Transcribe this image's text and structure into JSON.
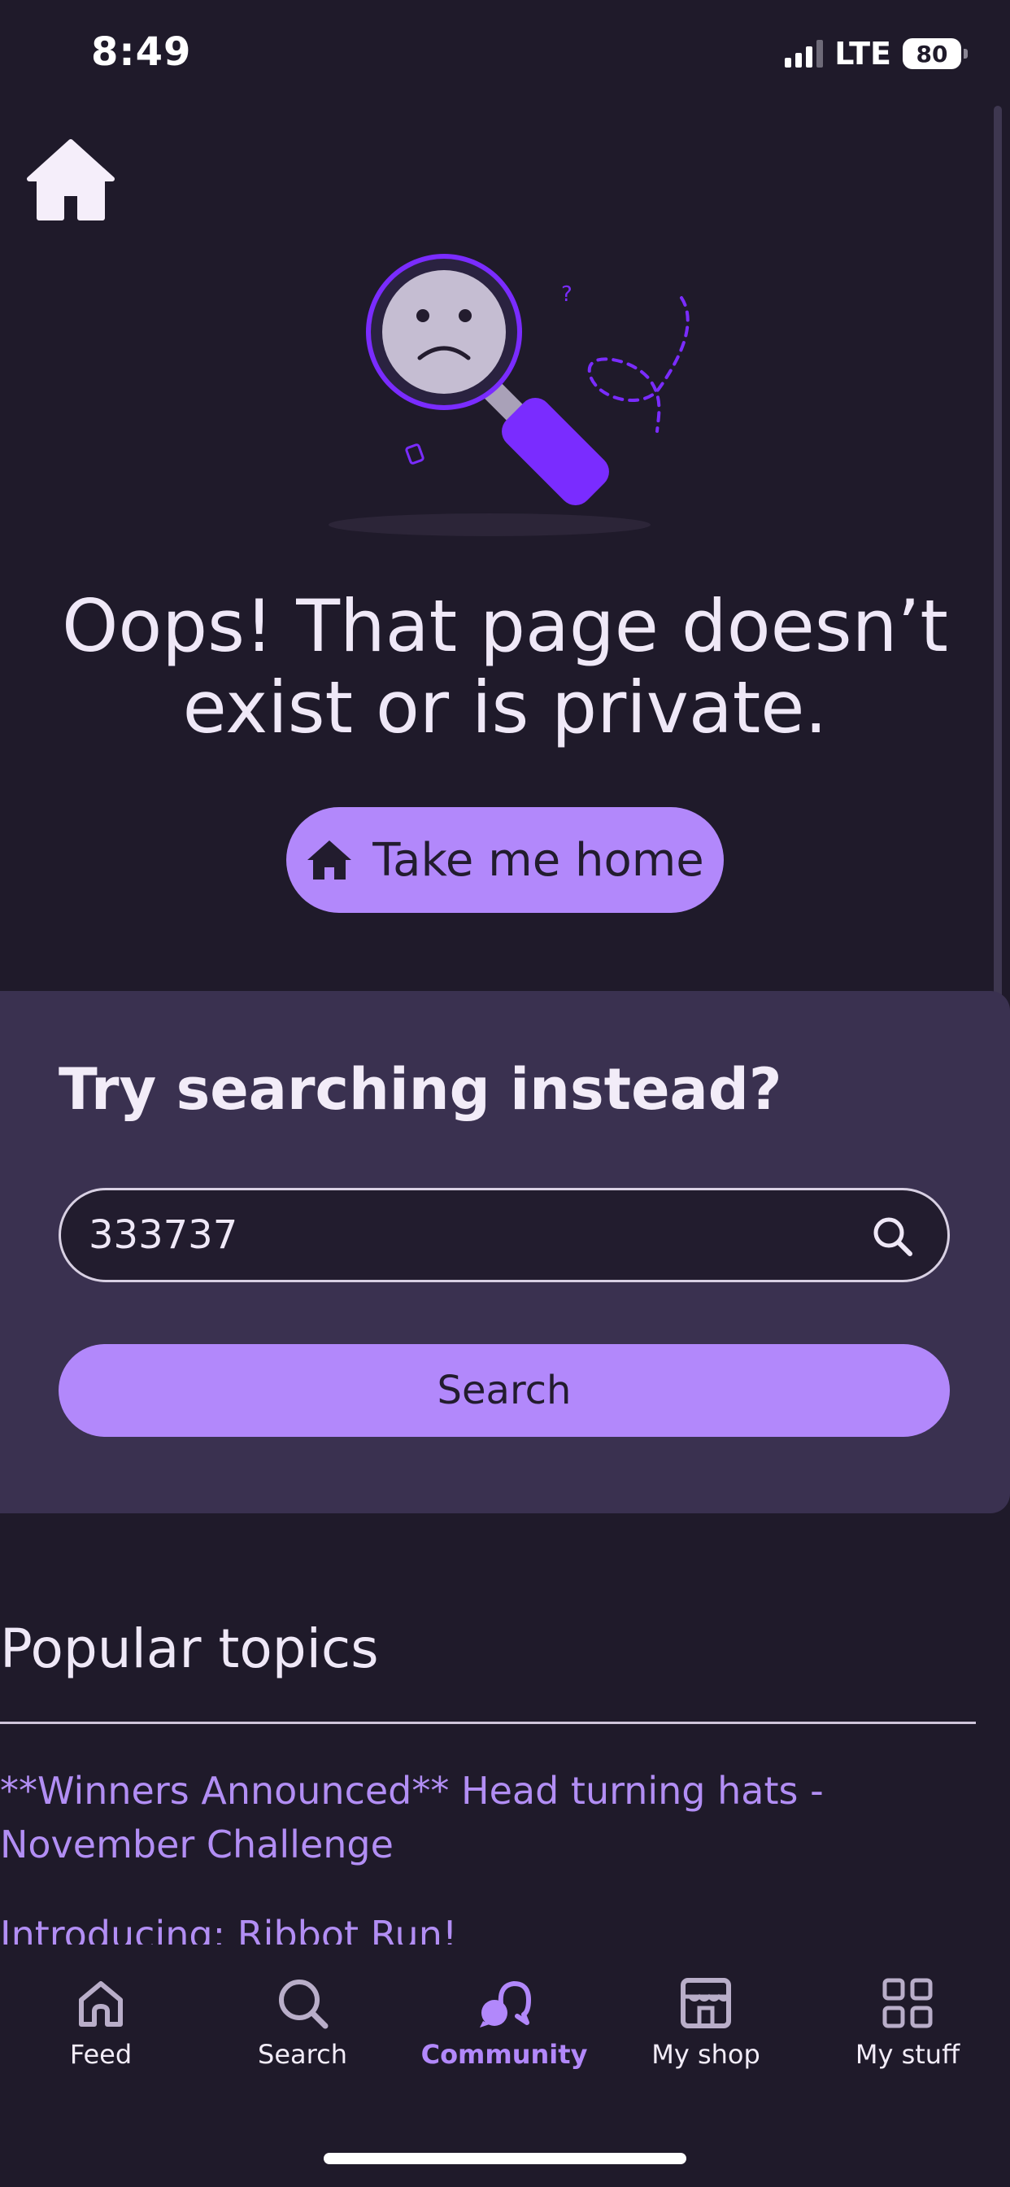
{
  "status_bar": {
    "time": "8:49",
    "network": "LTE",
    "battery": "80"
  },
  "error": {
    "headline": "Oops! That page doesn’t exist or is private.",
    "home_button_label": "Take me home"
  },
  "search_panel": {
    "heading": "Try searching instead?",
    "input_value": "333737",
    "submit_label": "Search"
  },
  "popular": {
    "heading": "Popular topics",
    "topics": [
      "**Winners Announced** Head turning hats - November Challenge",
      "Introducing: Ribbot Run!"
    ]
  },
  "bottom_nav": {
    "items": [
      {
        "label": "Feed",
        "icon": "home-icon"
      },
      {
        "label": "Search",
        "icon": "search-icon"
      },
      {
        "label": "Community",
        "icon": "chat-bubbles-icon",
        "active": true
      },
      {
        "label": "My shop",
        "icon": "shop-icon"
      },
      {
        "label": "My stuff",
        "icon": "grid-icon"
      }
    ]
  },
  "colors": {
    "background": "#1f1a2a",
    "panel": "#3a3150",
    "accent": "#b288fb",
    "link": "#b28ef4",
    "illustration_purple": "#7a2cff"
  }
}
